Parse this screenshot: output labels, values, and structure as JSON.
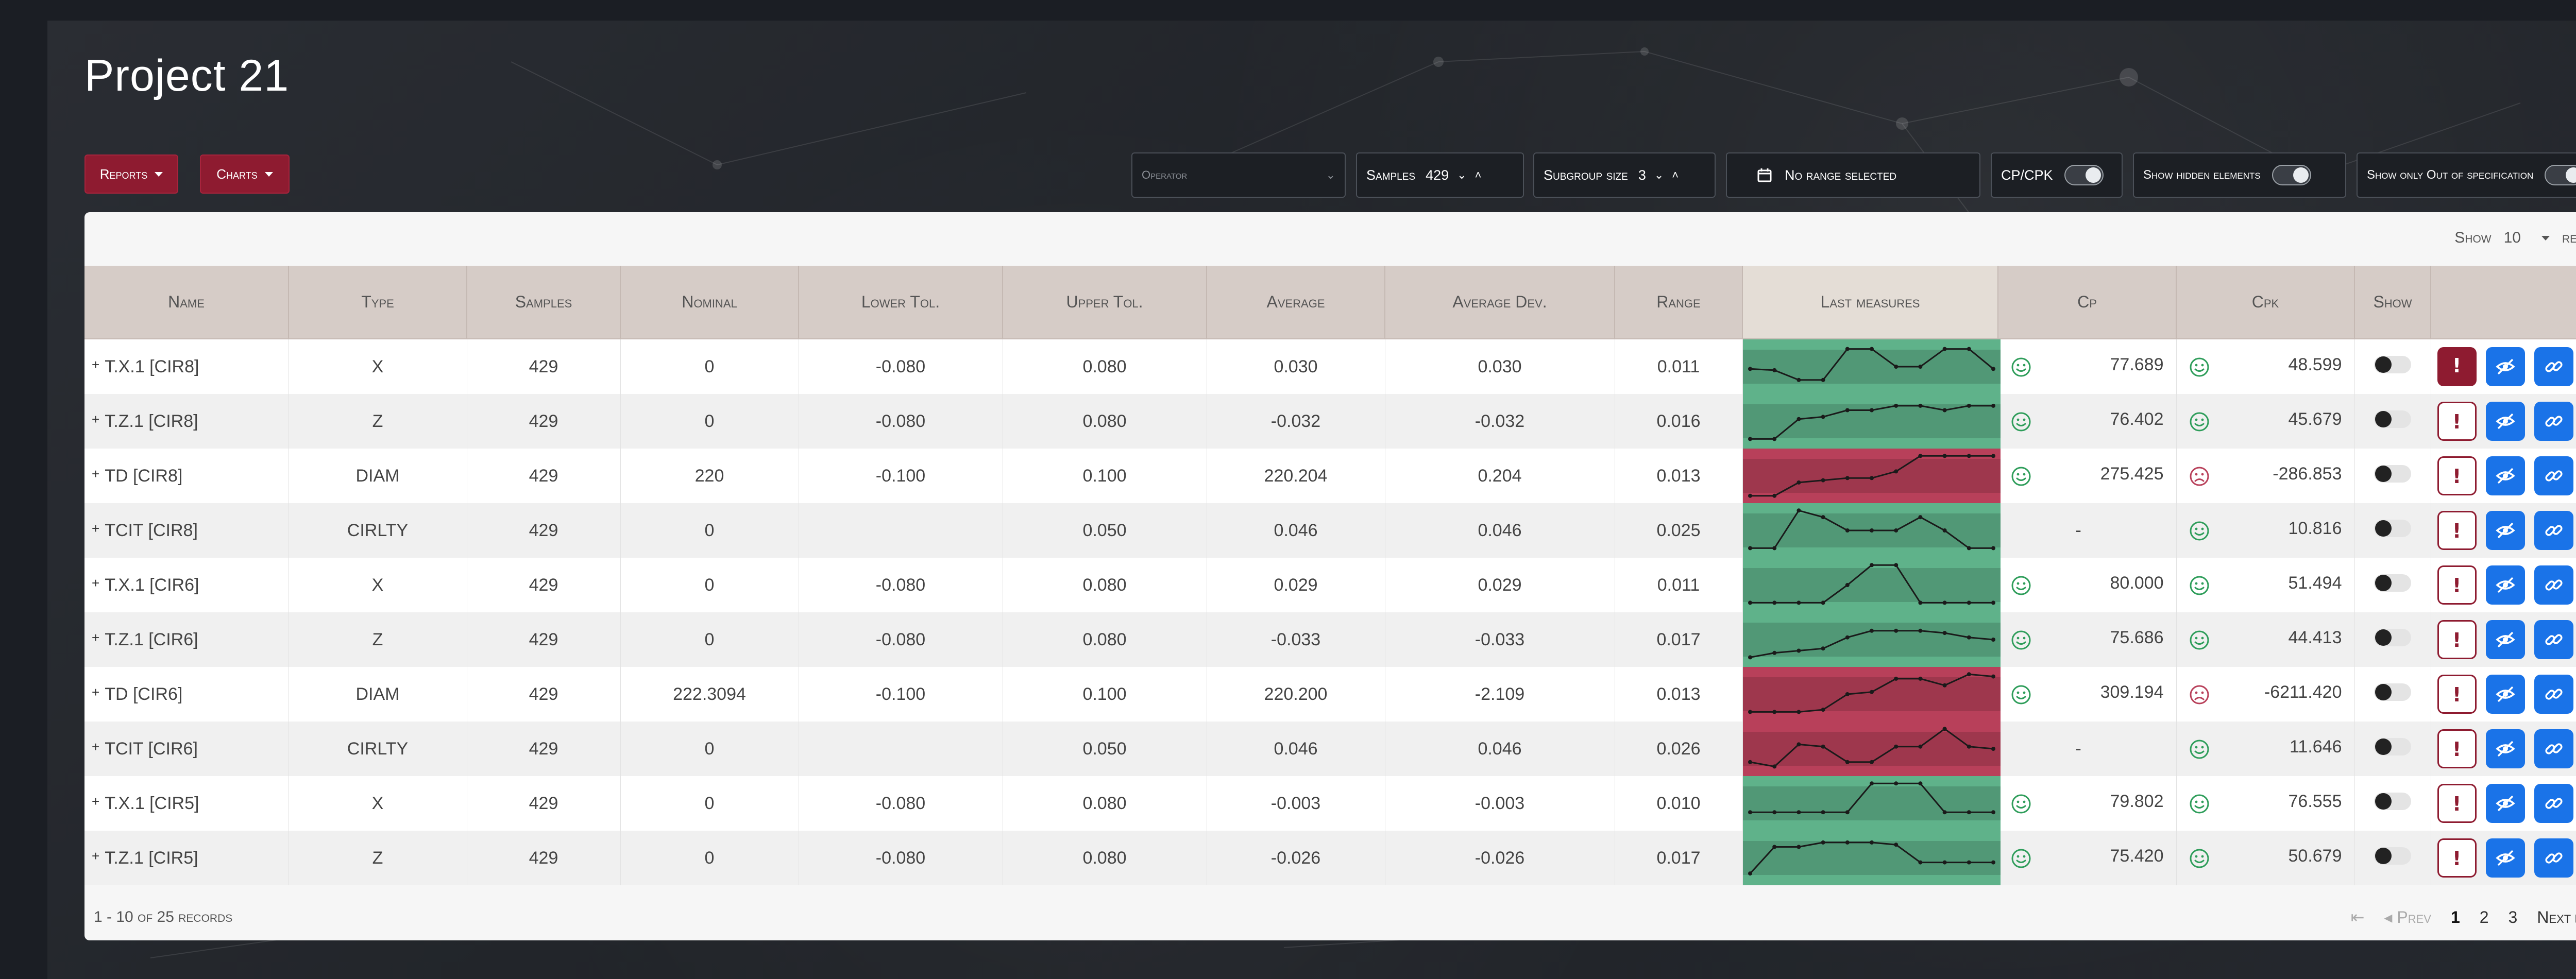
{
  "page": {
    "title": "Project 21"
  },
  "toolbar": {
    "reports_label": "Reports",
    "charts_label": "Charts",
    "operator_placeholder": "Operator",
    "samples_label": "Samples",
    "samples_value": "429",
    "subgroup_label": "Subgroup size",
    "subgroup_value": "3",
    "range_label": "No range selected",
    "cpcpk_label": "CP/CPK",
    "show_hidden_label": "Show hidden elements",
    "show_oos_label": "Show only Out of specification"
  },
  "table": {
    "show_label": "Show",
    "show_value": "10",
    "records_label": "records",
    "columns": [
      "Name",
      "Type",
      "Samples",
      "Nominal",
      "Lower Tol.",
      "Upper Tol.",
      "Average",
      "Average Dev.",
      "Range",
      "Last measures",
      "Cp",
      "Cpk",
      "Show",
      ""
    ],
    "rows": [
      {
        "name": "T.X.1 [CIR8]",
        "type": "X",
        "samples": "429",
        "nominal": "0",
        "lower_tol": "-0.080",
        "upper_tol": "0.080",
        "average": "0.030",
        "average_dev": "0.030",
        "range": "0.011",
        "spark_status": "ok",
        "sparkline": [
          0.45,
          0.42,
          0.2,
          0.2,
          0.9,
          0.9,
          0.5,
          0.5,
          0.9,
          0.9,
          0.45
        ],
        "cp": "77.689",
        "cp_face": "happy",
        "cpk": "48.599",
        "cpk_face": "happy",
        "alert": "filled"
      },
      {
        "name": "T.Z.1 [CIR8]",
        "type": "Z",
        "samples": "429",
        "nominal": "0",
        "lower_tol": "-0.080",
        "upper_tol": "0.080",
        "average": "-0.032",
        "average_dev": "-0.032",
        "range": "0.016",
        "spark_status": "ok",
        "sparkline": [
          0.1,
          0.1,
          0.55,
          0.6,
          0.75,
          0.75,
          0.85,
          0.85,
          0.75,
          0.85,
          0.85
        ],
        "cp": "76.402",
        "cp_face": "happy",
        "cpk": "45.679",
        "cpk_face": "happy",
        "alert": "outline"
      },
      {
        "name": "TD [CIR8]",
        "type": "DIAM",
        "samples": "429",
        "nominal": "220",
        "lower_tol": "-0.100",
        "upper_tol": "0.100",
        "average": "220.204",
        "average_dev": "0.204",
        "range": "0.013",
        "spark_status": "bad",
        "sparkline": [
          0.05,
          0.05,
          0.35,
          0.4,
          0.45,
          0.45,
          0.6,
          0.95,
          0.95,
          0.95,
          0.95
        ],
        "cp": "275.425",
        "cp_face": "happy",
        "cpk": "-286.853",
        "cpk_face": "sad",
        "alert": "outline"
      },
      {
        "name": "TCIT [CIR8]",
        "type": "CIRLTY",
        "samples": "429",
        "nominal": "0",
        "lower_tol": "",
        "upper_tol": "0.050",
        "average": "0.046",
        "average_dev": "0.046",
        "range": "0.025",
        "spark_status": "ok",
        "sparkline": [
          0.1,
          0.1,
          0.95,
          0.8,
          0.5,
          0.5,
          0.5,
          0.8,
          0.5,
          0.1,
          0.1
        ],
        "cp": "-",
        "cp_face": "",
        "cpk": "10.816",
        "cpk_face": "happy",
        "alert": "outline"
      },
      {
        "name": "T.X.1 [CIR6]",
        "type": "X",
        "samples": "429",
        "nominal": "0",
        "lower_tol": "-0.080",
        "upper_tol": "0.080",
        "average": "0.029",
        "average_dev": "0.029",
        "range": "0.011",
        "spark_status": "ok",
        "sparkline": [
          0.1,
          0.1,
          0.1,
          0.1,
          0.5,
          0.95,
          0.95,
          0.1,
          0.1,
          0.1,
          0.1
        ],
        "cp": "80.000",
        "cp_face": "happy",
        "cpk": "51.494",
        "cpk_face": "happy",
        "alert": "outline"
      },
      {
        "name": "T.Z.1 [CIR6]",
        "type": "Z",
        "samples": "429",
        "nominal": "0",
        "lower_tol": "-0.080",
        "upper_tol": "0.080",
        "average": "-0.033",
        "average_dev": "-0.033",
        "range": "0.017",
        "spark_status": "ok",
        "sparkline": [
          0.1,
          0.2,
          0.25,
          0.3,
          0.55,
          0.7,
          0.7,
          0.7,
          0.65,
          0.55,
          0.5
        ],
        "cp": "75.686",
        "cp_face": "happy",
        "cpk": "44.413",
        "cpk_face": "happy",
        "alert": "outline"
      },
      {
        "name": "TD [CIR6]",
        "type": "DIAM",
        "samples": "429",
        "nominal": "222.3094",
        "lower_tol": "-0.100",
        "upper_tol": "0.100",
        "average": "220.200",
        "average_dev": "-2.109",
        "range": "0.013",
        "spark_status": "bad",
        "sparkline": [
          0.1,
          0.1,
          0.1,
          0.15,
          0.5,
          0.55,
          0.85,
          0.85,
          0.7,
          0.95,
          0.9
        ],
        "cp": "309.194",
        "cp_face": "happy",
        "cpk": "-6211.420",
        "cpk_face": "sad",
        "alert": "outline"
      },
      {
        "name": "TCIT [CIR6]",
        "type": "CIRLTY",
        "samples": "429",
        "nominal": "0",
        "lower_tol": "",
        "upper_tol": "0.050",
        "average": "0.046",
        "average_dev": "0.046",
        "range": "0.026",
        "spark_status": "bad",
        "sparkline": [
          0.2,
          0.1,
          0.6,
          0.55,
          0.2,
          0.2,
          0.55,
          0.55,
          0.95,
          0.55,
          0.5
        ],
        "cp": "-",
        "cp_face": "",
        "cpk": "11.646",
        "cpk_face": "happy",
        "alert": "outline"
      },
      {
        "name": "T.X.1 [CIR5]",
        "type": "X",
        "samples": "429",
        "nominal": "0",
        "lower_tol": "-0.080",
        "upper_tol": "0.080",
        "average": "-0.003",
        "average_dev": "-0.003",
        "range": "0.010",
        "spark_status": "ok",
        "sparkline": [
          0.3,
          0.3,
          0.3,
          0.3,
          0.3,
          0.95,
          0.95,
          0.95,
          0.3,
          0.3,
          0.3
        ],
        "cp": "79.802",
        "cp_face": "happy",
        "cpk": "76.555",
        "cpk_face": "happy",
        "alert": "outline"
      },
      {
        "name": "T.Z.1 [CIR5]",
        "type": "Z",
        "samples": "429",
        "nominal": "0",
        "lower_tol": "-0.080",
        "upper_tol": "0.080",
        "average": "-0.026",
        "average_dev": "-0.026",
        "range": "0.017",
        "spark_status": "ok",
        "sparkline": [
          0.15,
          0.75,
          0.75,
          0.85,
          0.85,
          0.85,
          0.8,
          0.4,
          0.4,
          0.4,
          0.4
        ],
        "cp": "75.420",
        "cp_face": "happy",
        "cpk": "50.679",
        "cpk_face": "happy",
        "alert": "outline"
      }
    ]
  },
  "footer": {
    "records_info": "1 - 10 of 25 records",
    "prev_label": "Prev",
    "next_label": "Next",
    "pages": [
      "1",
      "2",
      "3"
    ],
    "current_page": "1"
  },
  "colors": {
    "accent_red": "#8e1b30",
    "action_blue": "#1a73e8",
    "spark_ok": "#5fb28a",
    "spark_bad": "#b8405a",
    "smile_green": "#2e9d5a",
    "sad_red": "#b8405a"
  }
}
